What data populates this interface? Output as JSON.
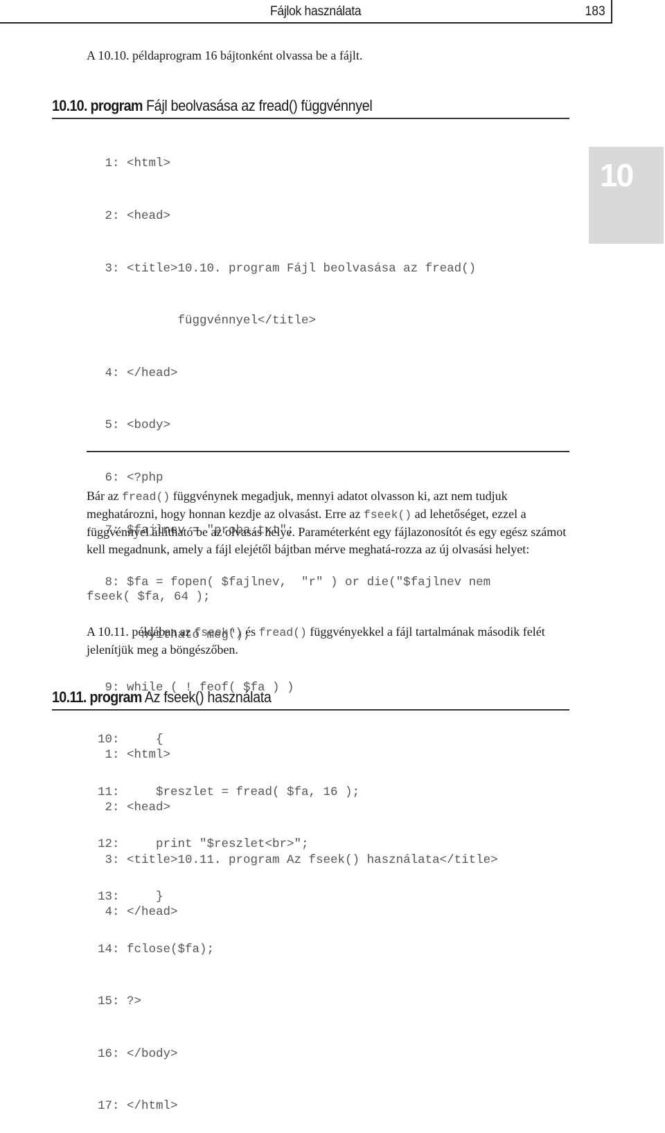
{
  "header": {
    "title": "Fájlok használata",
    "page_number": "183"
  },
  "chapter_tab": {
    "number": "10"
  },
  "intro": "A 10.10. példaprogram 16 bájtonként olvassa be a fájlt.",
  "listing_1": {
    "label": "10.10. program",
    "title": "Fájl beolvasása az fread() függvénnyel",
    "lines": [
      " 1: <html>",
      " 2: <head>",
      " 3: <title>10.10. program Fájl beolvasása az fread()",
      "           függvénnyel</title>",
      " 4: </head>",
      " 5: <body>",
      " 6: <?php",
      " 7: $fajlnev = \"proba.txt\";",
      " 8: $fa = fopen( $fajlnev,  \"r\" ) or die(\"$fajlnev nem",
      "      nyitható meg\");",
      " 9: while ( ! feof( $fa ) )",
      "10:     {",
      "11:     $reszlet = fread( $fa, 16 );",
      "12:     print \"$reszlet<br>\";",
      "13:     }",
      "14: fclose($fa);",
      "15: ?>",
      "16: </body>",
      "17: </html>"
    ]
  },
  "paragraph_1": {
    "t1": "Bár az ",
    "c1": "fread()",
    "t2": " függvénynek megadjuk, mennyi adatot olvasson ki, azt nem tudjuk meghatározni, hogy honnan kezdje az olvasást. Erre az ",
    "c2": "fseek()",
    "t3": " ad lehetőséget, ezzel a függvénnyel állítható be az olvasás helye. Paraméterként egy fájlazonosítót és egy egész számot kell megadnunk, amely a fájl elejétől bájtban mérve meghatá-rozza az új olvasási helyet:"
  },
  "code_sample": "fseek( $fa, 64 );",
  "paragraph_2": {
    "t1": "A 10.11. példában az ",
    "c1": "fseek()",
    "t2": " és ",
    "c2": "fread()",
    "t3": " függvényekkel a fájl tartalmának második felét jelenítjük meg a böngészőben."
  },
  "listing_2": {
    "label": "10.11. program",
    "title": "Az fseek() használata",
    "lines": [
      " 1: <html>",
      " 2: <head>",
      " 3: <title>10.11. program Az fseek() használata</title>",
      " 4: </head>"
    ]
  }
}
